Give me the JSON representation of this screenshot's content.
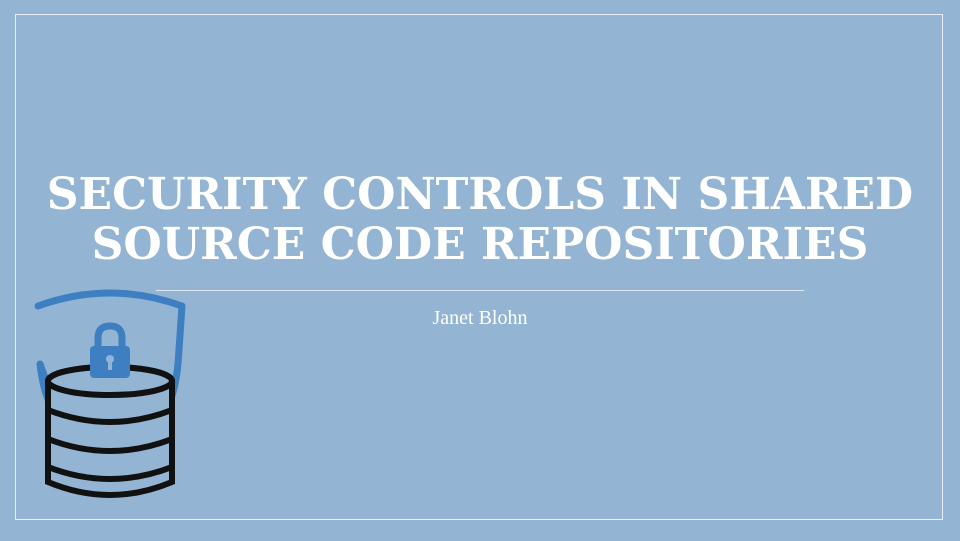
{
  "slide": {
    "title_line1": "Security Controls in Shared",
    "title_line2": "Source Code Repositories",
    "author": "Janet Blohn"
  },
  "icons": {
    "graphic": "shield-lock-database-icon"
  },
  "colors": {
    "background": "#93b4d2",
    "shield": "#3d7fc1",
    "database_outline": "#111111",
    "text": "#ffffff"
  }
}
